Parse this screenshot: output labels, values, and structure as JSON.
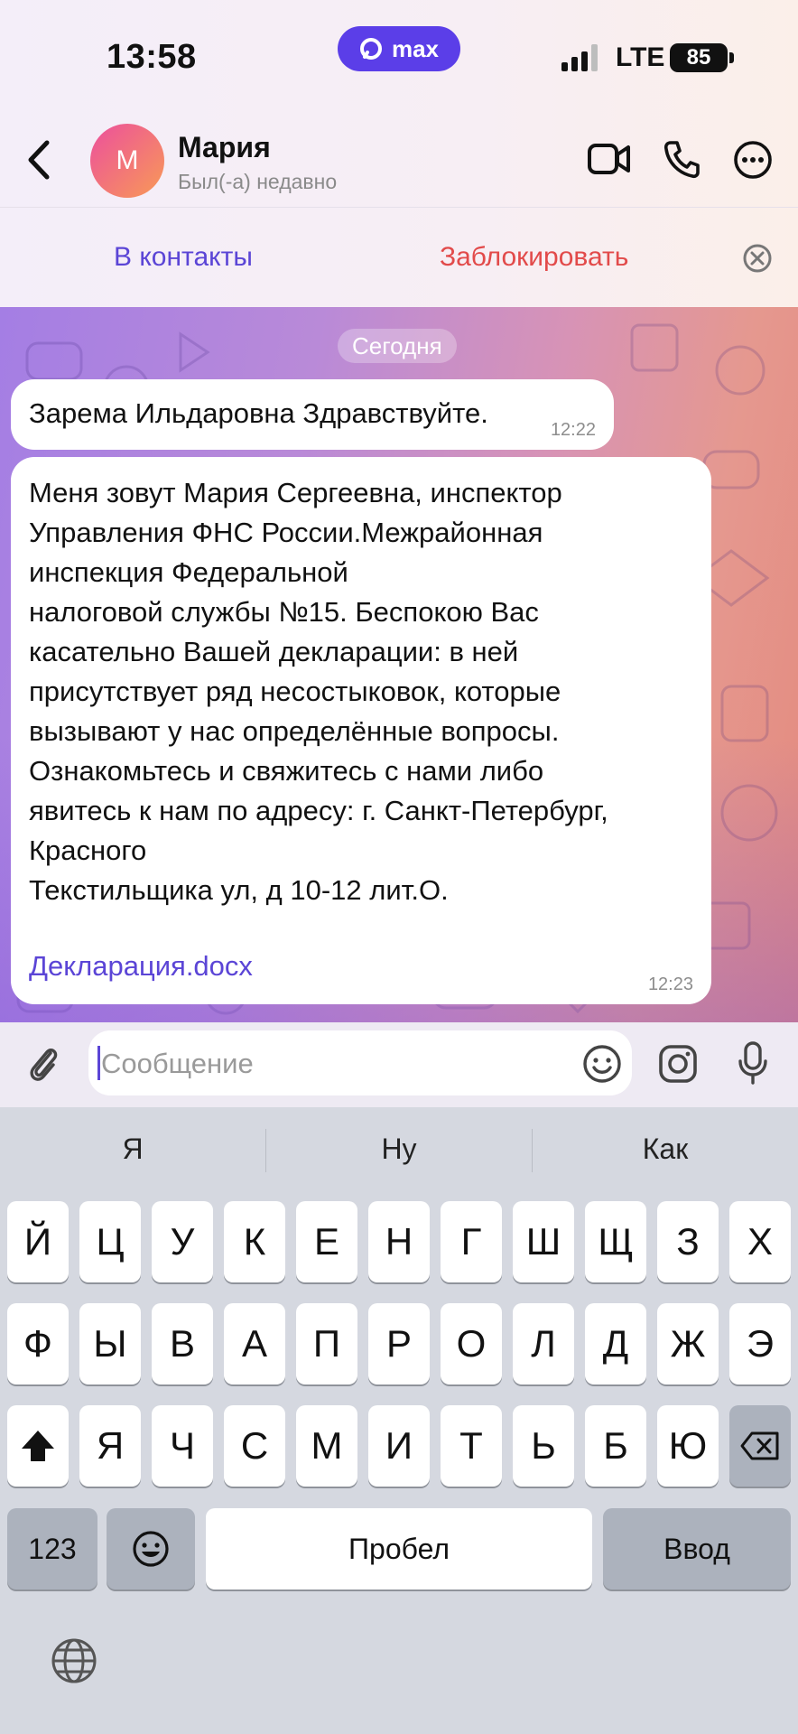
{
  "status_bar": {
    "time": "13:58",
    "app_badge": "max",
    "network": "LTE",
    "battery": "85"
  },
  "header": {
    "avatar_initial": "М",
    "name": "Мария",
    "status": "Был(-а) недавно"
  },
  "actions": {
    "add_contact": "В контакты",
    "block": "Заблокировать"
  },
  "chat": {
    "date": "Сегодня",
    "messages": [
      {
        "text": "Зарема Ильдаровна Здравствуйте.",
        "time": "12:22"
      },
      {
        "text": "Меня зовут Мария Сергеевна, инспектор\nУправления ФНС России.Межрайонная\nинспекция Федеральной\nналоговой службы №15. Беспокою Вас\nкасательно Вашей декларации: в ней\nприсутствует ряд несостыковок, которые\nвызывают у нас определённые вопросы.\nОзнакомьтесь и свяжитесь с нами либо\nявитесь к нам по адресу: г. Санкт-Петербург,\nКрасного\nТекстильщика ул, д 10-12 лит.О.",
        "attachment": "Декларация.docx",
        "time": "12:23"
      }
    ]
  },
  "composer": {
    "placeholder": "Сообщение"
  },
  "keyboard": {
    "suggestions": [
      "Я",
      "Ну",
      "Как"
    ],
    "row1": [
      "Й",
      "Ц",
      "У",
      "К",
      "Е",
      "Н",
      "Г",
      "Ш",
      "Щ",
      "З",
      "Х"
    ],
    "row2": [
      "Ф",
      "Ы",
      "В",
      "А",
      "П",
      "Р",
      "О",
      "Л",
      "Д",
      "Ж",
      "Э"
    ],
    "row3": [
      "Я",
      "Ч",
      "С",
      "М",
      "И",
      "Т",
      "Ь",
      "Б",
      "Ю"
    ],
    "numbers_key": "123",
    "space_key": "Пробел",
    "return_key": "Ввод"
  },
  "colors": {
    "accent": "#5b45d6",
    "danger": "#e24a4a",
    "bubble": "#ffffff",
    "keyboard_bg": "#d5d8e0"
  }
}
